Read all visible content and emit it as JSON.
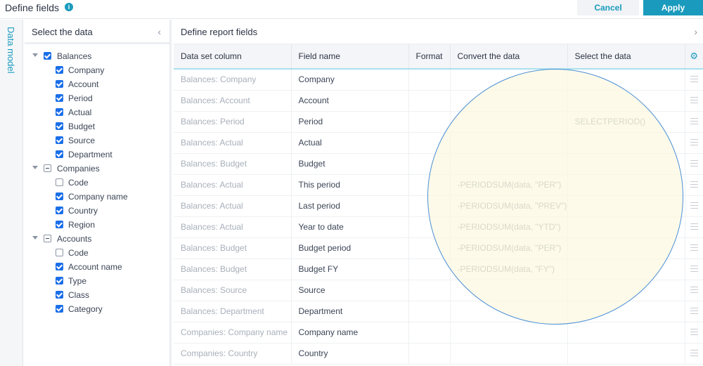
{
  "header": {
    "title": "Define fields",
    "info_icon": "info-icon",
    "cancel_label": "Cancel",
    "apply_label": "Apply"
  },
  "rail": {
    "label": "Data model"
  },
  "left_panel": {
    "title": "Select the data",
    "collapse_icon": "chevron-left-icon",
    "tree": [
      {
        "label": "Balances",
        "state": "checked",
        "children": [
          {
            "label": "Company",
            "state": "checked"
          },
          {
            "label": "Account",
            "state": "checked"
          },
          {
            "label": "Period",
            "state": "checked"
          },
          {
            "label": "Actual",
            "state": "checked"
          },
          {
            "label": "Budget",
            "state": "checked"
          },
          {
            "label": "Source",
            "state": "checked"
          },
          {
            "label": "Department",
            "state": "checked"
          }
        ]
      },
      {
        "label": "Companies",
        "state": "partial",
        "children": [
          {
            "label": "Code",
            "state": "unchecked"
          },
          {
            "label": "Company name",
            "state": "checked"
          },
          {
            "label": "Country",
            "state": "checked"
          },
          {
            "label": "Region",
            "state": "checked"
          }
        ]
      },
      {
        "label": "Accounts",
        "state": "partial",
        "children": [
          {
            "label": "Code",
            "state": "unchecked"
          },
          {
            "label": "Account name",
            "state": "checked"
          },
          {
            "label": "Type",
            "state": "checked"
          },
          {
            "label": "Class",
            "state": "checked"
          },
          {
            "label": "Category",
            "state": "checked"
          }
        ]
      }
    ]
  },
  "main": {
    "title": "Define report fields",
    "expand_icon": "chevron-right-icon",
    "columns": [
      "Data set column",
      "Field name",
      "Format",
      "Convert the data",
      "Select the data"
    ],
    "settings_icon": "gear-icon",
    "rows": [
      {
        "source": "Balances: Company",
        "field": "Company",
        "format": "",
        "convert": "",
        "select": ""
      },
      {
        "source": "Balances: Account",
        "field": "Account",
        "format": "",
        "convert": "",
        "select": ""
      },
      {
        "source": "Balances: Period",
        "field": "Period",
        "format": "",
        "convert": "",
        "select": "SELECTPERIOD()"
      },
      {
        "source": "Balances: Actual",
        "field": "Actual",
        "format": "",
        "convert": "",
        "select": ""
      },
      {
        "source": "Balances: Budget",
        "field": "Budget",
        "format": "",
        "convert": "",
        "select": ""
      },
      {
        "source": "Balances: Actual",
        "field": "This period",
        "format": "",
        "convert": "-PERIODSUM(data, \"PER\")",
        "select": ""
      },
      {
        "source": "Balances: Actual",
        "field": "Last period",
        "format": "",
        "convert": "-PERIODSUM(data, \"PREV\")",
        "select": ""
      },
      {
        "source": "Balances: Actual",
        "field": "Year to date",
        "format": "",
        "convert": "-PERIODSUM(data, \"YTD\")",
        "select": ""
      },
      {
        "source": "Balances: Budget",
        "field": "Budget period",
        "format": "",
        "convert": "-PERIODSUM(data, \"PER\")",
        "select": ""
      },
      {
        "source": "Balances: Budget",
        "field": "Budget FY",
        "format": "",
        "convert": "-PERIODSUM(data, \"FY\")",
        "select": ""
      },
      {
        "source": "Balances: Source",
        "field": "Source",
        "format": "",
        "convert": "",
        "select": ""
      },
      {
        "source": "Balances: Department",
        "field": "Department",
        "format": "",
        "convert": "",
        "select": ""
      },
      {
        "source": "Companies: Company name",
        "field": "Company name",
        "format": "",
        "convert": "",
        "select": ""
      },
      {
        "source": "Companies: Country",
        "field": "Country",
        "format": "",
        "convert": "",
        "select": ""
      }
    ]
  },
  "colors": {
    "accent": "#1a9bbd",
    "checkbox": "#1a6ee8",
    "spotlight_fill": "#fcf8e2",
    "spotlight_border": "#4a8fd6"
  }
}
